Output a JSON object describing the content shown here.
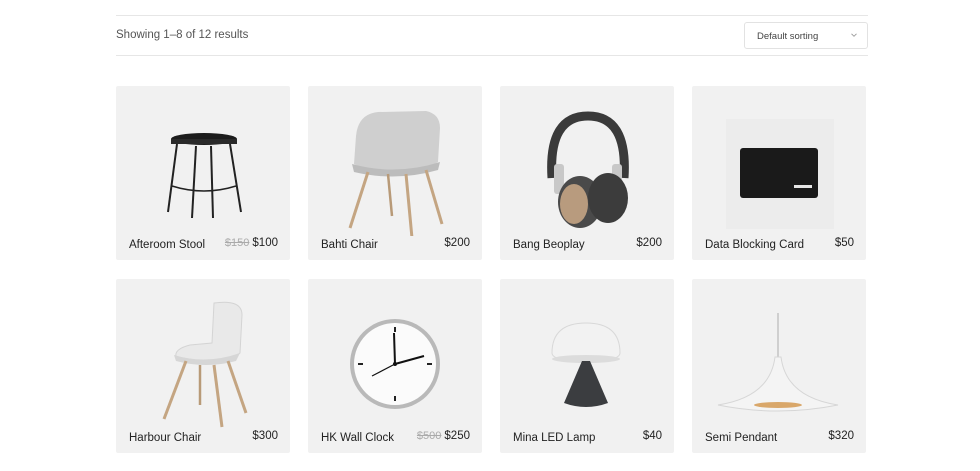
{
  "toolbar": {
    "result_count": "Showing 1–8 of 12 results",
    "sort": {
      "selected": "Default sorting",
      "icon": "chevron-down-icon"
    }
  },
  "products": [
    {
      "name": "Afteroom Stool",
      "old_price": "$150",
      "price": "$100"
    },
    {
      "name": "Bahti Chair",
      "old_price": "",
      "price": "$200"
    },
    {
      "name": "Bang Beoplay",
      "old_price": "",
      "price": "$200"
    },
    {
      "name": "Data Blocking Card",
      "old_price": "",
      "price": "$50"
    },
    {
      "name": "Harbour Chair",
      "old_price": "",
      "price": "$300"
    },
    {
      "name": "HK Wall Clock",
      "old_price": "$500",
      "price": "$250"
    },
    {
      "name": "Mina LED Lamp",
      "old_price": "",
      "price": "$40"
    },
    {
      "name": "Semi Pendant",
      "old_price": "",
      "price": "$320"
    }
  ]
}
